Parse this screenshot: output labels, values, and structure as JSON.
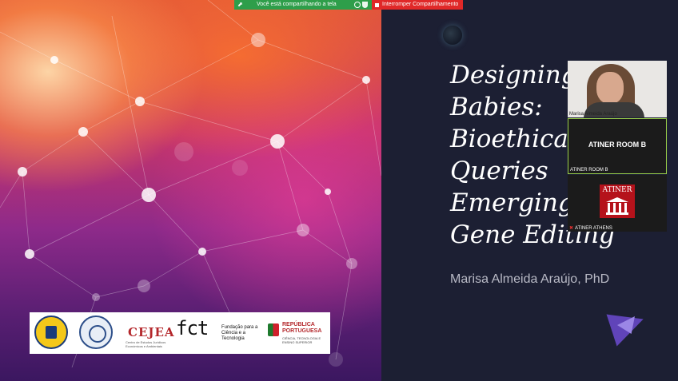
{
  "share_bar": {
    "text": "Você está compartilhando a tela",
    "stop_label": "Interromper Compartilhamento"
  },
  "slide": {
    "title_lines": [
      "Designing",
      "Babies:",
      "Bioethical",
      "Queries",
      "Emerging",
      "Gene Editing"
    ],
    "author": "Marisa Almeida Araújo, PhD",
    "logos": {
      "cejea": "CEJEA",
      "cejea_sub": "Centro de Estudos Jurídicos Económicos e Ambientais",
      "fct_mark": "fct",
      "fct_text": "Fundação para a Ciência e a Tecnologia",
      "rep_title": "REPÚBLICA PORTUGUESA",
      "rep_sub": "CIÊNCIA, TECNOLOGIA E ENSINO SUPERIOR"
    }
  },
  "participants": [
    {
      "name": "Marisa Almeida Araújo"
    },
    {
      "name": "ATINER ROOM B",
      "label": "ATINER ROOM B"
    },
    {
      "name": "ATINER ATHENS",
      "logo": "ATINER"
    }
  ]
}
